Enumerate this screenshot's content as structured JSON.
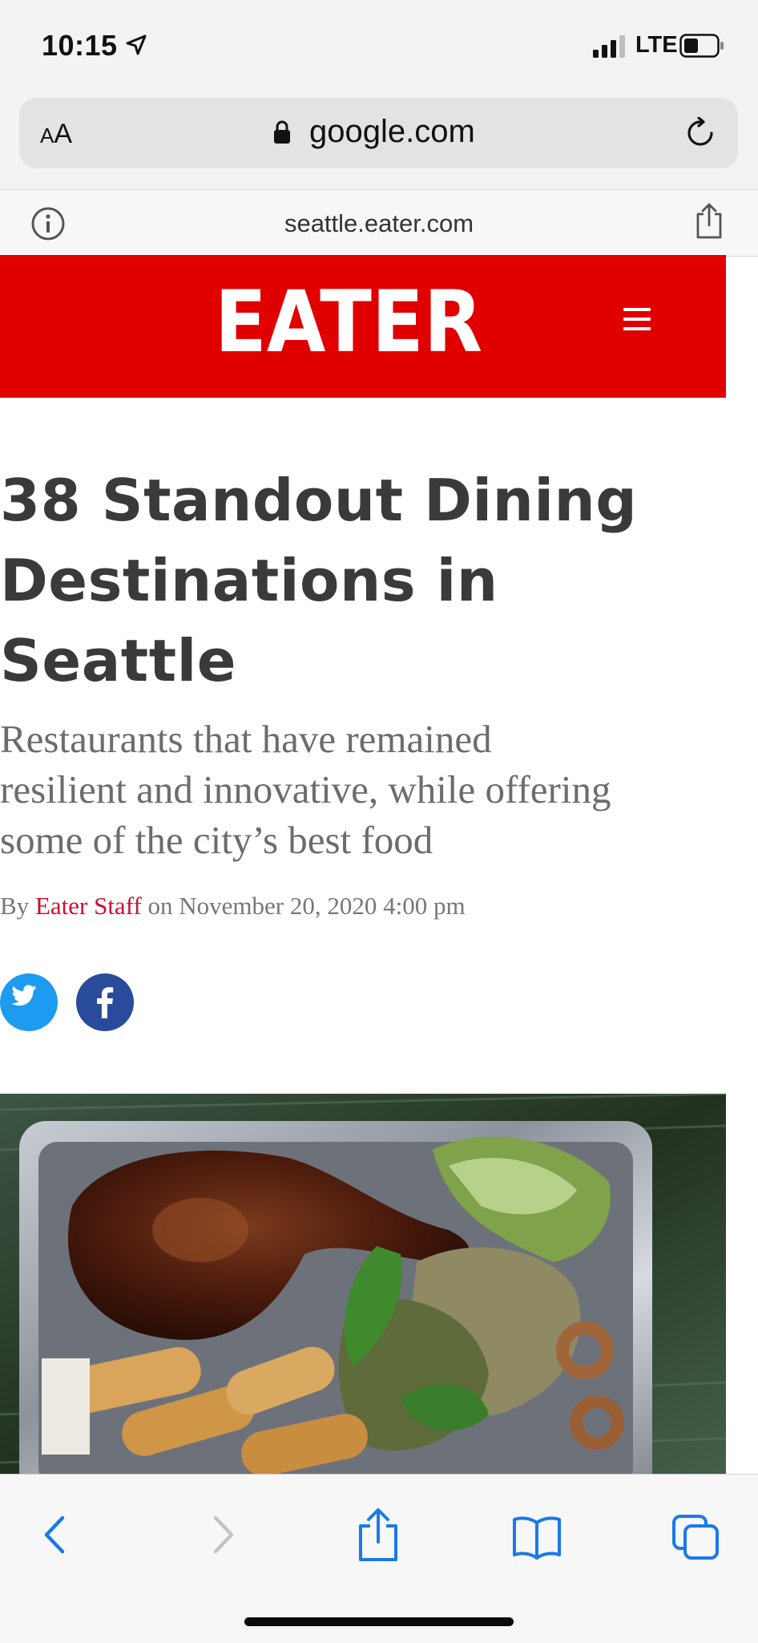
{
  "status_bar": {
    "time": "10:15",
    "carrier": "LTE"
  },
  "address_bar": {
    "aa_small": "A",
    "aa_large": "A",
    "domain": "google.com"
  },
  "page_strip": {
    "url": "seattle.eater.com"
  },
  "site": {
    "logo_text": "EATER",
    "brand_color": "#e10000"
  },
  "article": {
    "headline_lines": [
      "38 Standout Dining",
      "Destinations in",
      "Seattle"
    ],
    "dek_lines": [
      "Restaurants that have remained",
      "resilient and innovative, while offering",
      "some of the city’s best food"
    ],
    "byline_prefix": "By ",
    "author": "Eater Staff",
    "byline_date": " on November 20, 2020 4:00 pm"
  },
  "social": {
    "twitter_icon": "twitter-bird-icon",
    "facebook_icon": "facebook-f-icon",
    "twitter_color": "#1d9bf0",
    "facebook_color": "#294b9b"
  },
  "toolbar": {
    "icons": [
      "back-icon",
      "forward-icon",
      "share-icon",
      "bookmarks-icon",
      "tabs-icon"
    ],
    "accent": "#1a7ae8"
  }
}
